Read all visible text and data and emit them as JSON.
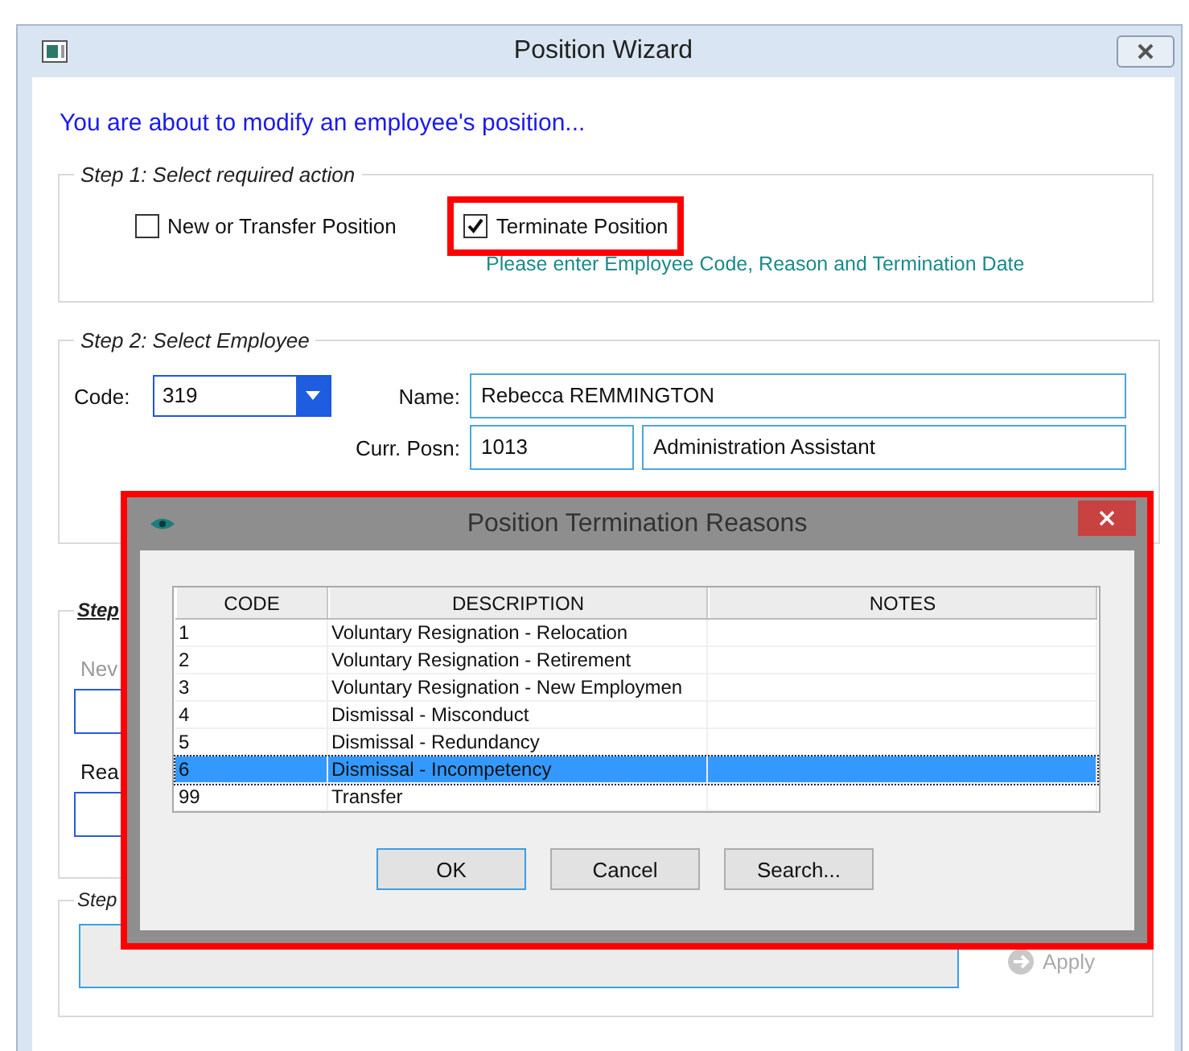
{
  "window": {
    "title": "Position Wizard",
    "intro": "You are about to modify an employee's position..."
  },
  "step1": {
    "legend": "Step 1:  Select required action",
    "options": [
      {
        "label": "New or Transfer Position",
        "checked": false,
        "highlighted": false
      },
      {
        "label": "Terminate Position",
        "checked": true,
        "highlighted": true
      }
    ],
    "hint": "Please enter Employee Code, Reason and Termination Date"
  },
  "step2": {
    "legend": "Step 2:  Select Employee",
    "code_label": "Code:",
    "code": "319",
    "name_label": "Name:",
    "name": "Rebecca REMMINGTON",
    "posn_label": "Curr. Posn:",
    "posn_code": "1013",
    "posn_title": "Administration Assistant"
  },
  "step3": {
    "legend": "Step",
    "field_1_label": "Nev",
    "field_2_label": "Rea"
  },
  "step4": {
    "legend": "Step",
    "apply": {
      "label": "Apply",
      "disabled": true
    }
  },
  "dialog": {
    "title": "Position Termination Reasons",
    "highlighted": true,
    "columns": [
      "CODE",
      "DESCRIPTION",
      "NOTES"
    ],
    "rows": [
      {
        "code": "1",
        "description": "Voluntary Resignation - Relocation",
        "selected": false
      },
      {
        "code": "2",
        "description": "Voluntary Resignation - Retirement",
        "selected": false
      },
      {
        "code": "3",
        "description": "Voluntary Resignation - New Employmen",
        "selected": false
      },
      {
        "code": "4",
        "description": "Dismissal - Misconduct",
        "selected": false
      },
      {
        "code": "5",
        "description": "Dismissal - Redundancy",
        "selected": false
      },
      {
        "code": "6",
        "description": "Dismissal - Incompetency",
        "selected": true
      },
      {
        "code": "99",
        "description": "Transfer",
        "selected": false
      }
    ],
    "buttons": [
      {
        "label": "OK",
        "default": true
      },
      {
        "label": "Cancel",
        "default": false
      },
      {
        "label": "Search...",
        "default": false
      }
    ]
  }
}
